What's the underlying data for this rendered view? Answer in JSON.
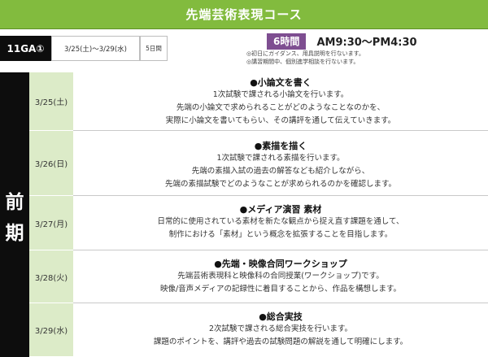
{
  "course_title": "先端芸術表現コース",
  "info": {
    "code": "11GA①",
    "dates": "3/25(土)〜3/29(水)",
    "days": "5日間",
    "hours": "6時間",
    "time": "AM9:30〜PM4:30",
    "notes": [
      "◎初日にガイダンス、用具説明を行ないます。",
      "◎講習期間中、個別進学相談を行ないます。"
    ]
  },
  "period_label": [
    "前",
    "期"
  ],
  "sessions": [
    {
      "date": "3/25(土)",
      "title": "●小論文を書く",
      "lines": [
        "1次試験で課される小論文を行います。",
        "先端の小論文で求められることがどのようなことなのかを、",
        "実際に小論文を書いてもらい、その講評を通して伝えていきます。"
      ]
    },
    {
      "date": "3/26(日)",
      "title": "●素描を描く",
      "lines": [
        "1次試験で課される素描を行います。",
        "先端の素描入試の過去の解答なども紹介しながら、",
        "先端の素描試験でどのようなことが求められるのかを確認します。"
      ]
    },
    {
      "date": "3/27(月)",
      "title": "●メディア演習 素材",
      "lines": [
        "日常的に使用されている素材を新たな観点から捉え直す課題を通して、",
        "制作における「素材」という概念を拡張することを目指します。"
      ]
    },
    {
      "date": "3/28(火)",
      "title": "●先端・映像合同ワークショップ",
      "lines": [
        "先端芸術表現科と映像科の合同授業(ワークショップ)です。",
        "映像/音声メディアの記録性に着目することから、作品を構想します。"
      ]
    },
    {
      "date": "3/29(水)",
      "title": "●総合実技",
      "lines": [
        "2次試験で課される総合実技を行います。",
        "課題のポイントを、講評や過去の試験問題の解説を通して明確にします。"
      ]
    }
  ],
  "colors": {
    "title_bg": "#82bb3e",
    "day_bg": "#dcebc8",
    "hours_bg": "#7e4e91",
    "period_bg": "#0d0d0d"
  }
}
